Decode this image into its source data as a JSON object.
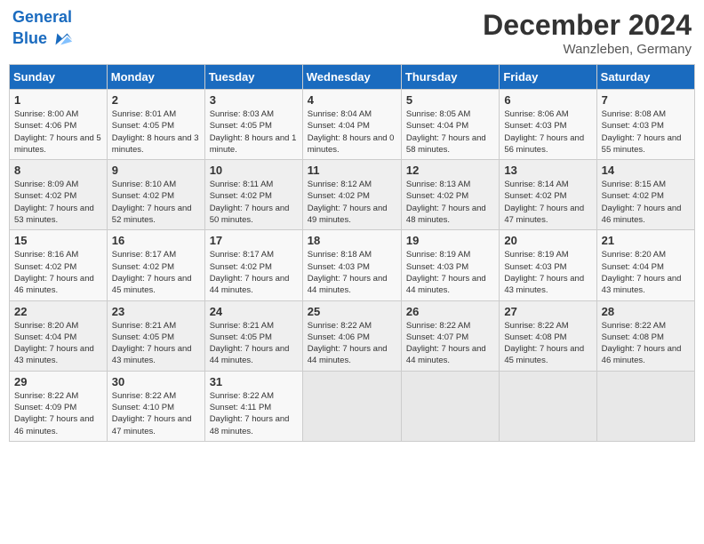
{
  "header": {
    "logo_line1": "General",
    "logo_line2": "Blue",
    "month": "December 2024",
    "location": "Wanzleben, Germany"
  },
  "weekdays": [
    "Sunday",
    "Monday",
    "Tuesday",
    "Wednesday",
    "Thursday",
    "Friday",
    "Saturday"
  ],
  "weeks": [
    [
      {
        "day": "1",
        "sunrise": "8:00 AM",
        "sunset": "4:06 PM",
        "daylight": "7 hours and 5 minutes."
      },
      {
        "day": "2",
        "sunrise": "8:01 AM",
        "sunset": "4:05 PM",
        "daylight": "8 hours and 3 minutes."
      },
      {
        "day": "3",
        "sunrise": "8:03 AM",
        "sunset": "4:05 PM",
        "daylight": "8 hours and 1 minute."
      },
      {
        "day": "4",
        "sunrise": "8:04 AM",
        "sunset": "4:04 PM",
        "daylight": "8 hours and 0 minutes."
      },
      {
        "day": "5",
        "sunrise": "8:05 AM",
        "sunset": "4:04 PM",
        "daylight": "7 hours and 58 minutes."
      },
      {
        "day": "6",
        "sunrise": "8:06 AM",
        "sunset": "4:03 PM",
        "daylight": "7 hours and 56 minutes."
      },
      {
        "day": "7",
        "sunrise": "8:08 AM",
        "sunset": "4:03 PM",
        "daylight": "7 hours and 55 minutes."
      }
    ],
    [
      {
        "day": "8",
        "sunrise": "8:09 AM",
        "sunset": "4:02 PM",
        "daylight": "7 hours and 53 minutes."
      },
      {
        "day": "9",
        "sunrise": "8:10 AM",
        "sunset": "4:02 PM",
        "daylight": "7 hours and 52 minutes."
      },
      {
        "day": "10",
        "sunrise": "8:11 AM",
        "sunset": "4:02 PM",
        "daylight": "7 hours and 50 minutes."
      },
      {
        "day": "11",
        "sunrise": "8:12 AM",
        "sunset": "4:02 PM",
        "daylight": "7 hours and 49 minutes."
      },
      {
        "day": "12",
        "sunrise": "8:13 AM",
        "sunset": "4:02 PM",
        "daylight": "7 hours and 48 minutes."
      },
      {
        "day": "13",
        "sunrise": "8:14 AM",
        "sunset": "4:02 PM",
        "daylight": "7 hours and 47 minutes."
      },
      {
        "day": "14",
        "sunrise": "8:15 AM",
        "sunset": "4:02 PM",
        "daylight": "7 hours and 46 minutes."
      }
    ],
    [
      {
        "day": "15",
        "sunrise": "8:16 AM",
        "sunset": "4:02 PM",
        "daylight": "7 hours and 46 minutes."
      },
      {
        "day": "16",
        "sunrise": "8:17 AM",
        "sunset": "4:02 PM",
        "daylight": "7 hours and 45 minutes."
      },
      {
        "day": "17",
        "sunrise": "8:17 AM",
        "sunset": "4:02 PM",
        "daylight": "7 hours and 44 minutes."
      },
      {
        "day": "18",
        "sunrise": "8:18 AM",
        "sunset": "4:03 PM",
        "daylight": "7 hours and 44 minutes."
      },
      {
        "day": "19",
        "sunrise": "8:19 AM",
        "sunset": "4:03 PM",
        "daylight": "7 hours and 44 minutes."
      },
      {
        "day": "20",
        "sunrise": "8:19 AM",
        "sunset": "4:03 PM",
        "daylight": "7 hours and 43 minutes."
      },
      {
        "day": "21",
        "sunrise": "8:20 AM",
        "sunset": "4:04 PM",
        "daylight": "7 hours and 43 minutes."
      }
    ],
    [
      {
        "day": "22",
        "sunrise": "8:20 AM",
        "sunset": "4:04 PM",
        "daylight": "7 hours and 43 minutes."
      },
      {
        "day": "23",
        "sunrise": "8:21 AM",
        "sunset": "4:05 PM",
        "daylight": "7 hours and 43 minutes."
      },
      {
        "day": "24",
        "sunrise": "8:21 AM",
        "sunset": "4:05 PM",
        "daylight": "7 hours and 44 minutes."
      },
      {
        "day": "25",
        "sunrise": "8:22 AM",
        "sunset": "4:06 PM",
        "daylight": "7 hours and 44 minutes."
      },
      {
        "day": "26",
        "sunrise": "8:22 AM",
        "sunset": "4:07 PM",
        "daylight": "7 hours and 44 minutes."
      },
      {
        "day": "27",
        "sunrise": "8:22 AM",
        "sunset": "4:08 PM",
        "daylight": "7 hours and 45 minutes."
      },
      {
        "day": "28",
        "sunrise": "8:22 AM",
        "sunset": "4:08 PM",
        "daylight": "7 hours and 46 minutes."
      }
    ],
    [
      {
        "day": "29",
        "sunrise": "8:22 AM",
        "sunset": "4:09 PM",
        "daylight": "7 hours and 46 minutes."
      },
      {
        "day": "30",
        "sunrise": "8:22 AM",
        "sunset": "4:10 PM",
        "daylight": "7 hours and 47 minutes."
      },
      {
        "day": "31",
        "sunrise": "8:22 AM",
        "sunset": "4:11 PM",
        "daylight": "7 hours and 48 minutes."
      },
      null,
      null,
      null,
      null
    ]
  ]
}
